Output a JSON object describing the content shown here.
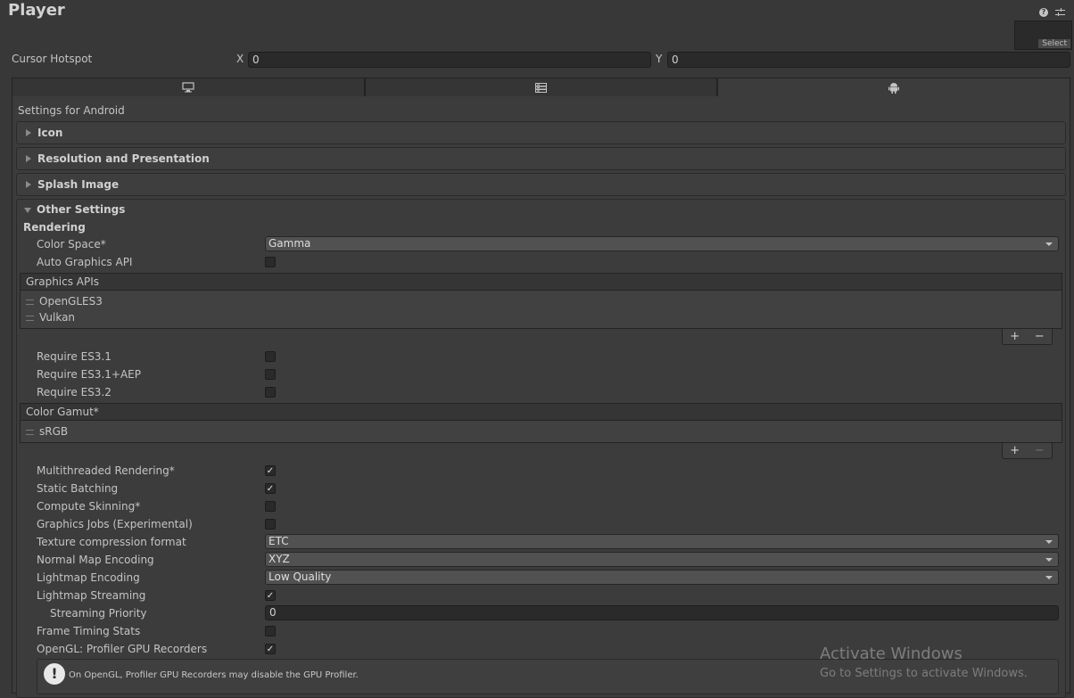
{
  "header": {
    "title": "Player",
    "select_label": "Select"
  },
  "cursor_hotspot": {
    "label": "Cursor Hotspot",
    "x_label": "X",
    "x_value": "0",
    "y_label": "Y",
    "y_value": "0"
  },
  "tabs": [
    {
      "icon": "monitor-icon"
    },
    {
      "icon": "server-icon"
    },
    {
      "icon": "android-icon",
      "active": true
    }
  ],
  "settings_for": "Settings for Android",
  "sections": {
    "icon": "Icon",
    "resolution": "Resolution and Presentation",
    "splash": "Splash Image",
    "other": "Other Settings"
  },
  "rendering": {
    "heading": "Rendering",
    "color_space": {
      "label": "Color Space*",
      "value": "Gamma"
    },
    "auto_graphics_api": {
      "label": "Auto Graphics API",
      "checked": false
    },
    "graphics_apis": {
      "header": "Graphics APIs",
      "items": [
        "OpenGLES3",
        "Vulkan"
      ]
    },
    "require_es31": {
      "label": "Require ES3.1",
      "checked": false
    },
    "require_es31_aep": {
      "label": "Require ES3.1+AEP",
      "checked": false
    },
    "require_es32": {
      "label": "Require ES3.2",
      "checked": false
    },
    "color_gamut": {
      "header": "Color Gamut*",
      "items": [
        "sRGB"
      ]
    },
    "multithreaded": {
      "label": "Multithreaded Rendering*",
      "checked": true
    },
    "static_batching": {
      "label": "Static Batching",
      "checked": true
    },
    "compute_skinning": {
      "label": "Compute Skinning*",
      "checked": false
    },
    "graphics_jobs": {
      "label": "Graphics Jobs (Experimental)",
      "checked": false
    },
    "texture_compression": {
      "label": "Texture compression format",
      "value": "ETC"
    },
    "normal_map": {
      "label": "Normal Map Encoding",
      "value": "XYZ"
    },
    "lightmap_encoding": {
      "label": "Lightmap Encoding",
      "value": "Low Quality"
    },
    "lightmap_streaming": {
      "label": "Lightmap Streaming",
      "checked": true
    },
    "streaming_priority": {
      "label": "Streaming Priority",
      "value": "0"
    },
    "frame_timing": {
      "label": "Frame Timing Stats",
      "checked": false
    },
    "opengl_profiler": {
      "label": "OpenGL: Profiler GPU Recorders",
      "checked": true
    },
    "warning": "On OpenGL, Profiler GPU Recorders may disable the GPU Profiler."
  },
  "list_buttons": {
    "add": "+",
    "remove": "−"
  },
  "watermark": {
    "line1": "Activate Windows",
    "line2": "Go to Settings to activate Windows."
  },
  "colors": {
    "background": "#383838",
    "panel": "#3c3c3c",
    "field": "#2a2a2a",
    "text": "#c4c4c4"
  }
}
